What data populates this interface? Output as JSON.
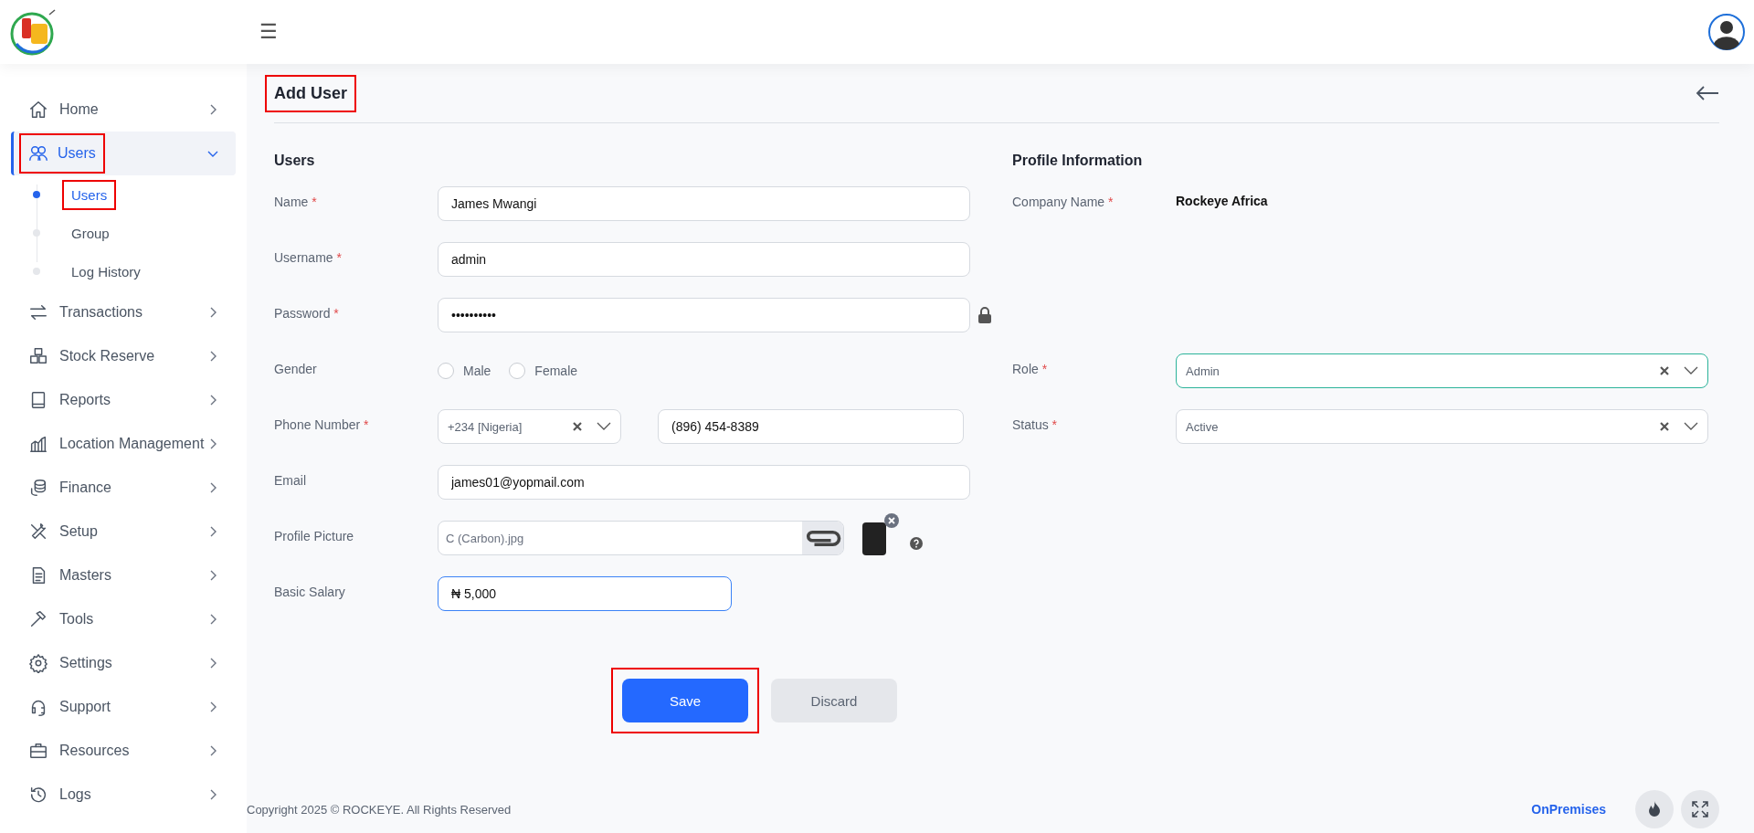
{
  "header": {
    "menu_label": "☰"
  },
  "sidebar": {
    "items": [
      {
        "label": "Home",
        "selected": false,
        "expanded": false,
        "highlighted": false
      },
      {
        "label": "Users",
        "selected": true,
        "expanded": true,
        "highlighted": true,
        "children": [
          {
            "label": "Users",
            "selected": true,
            "highlighted": true
          },
          {
            "label": "Group",
            "selected": false,
            "highlighted": false
          },
          {
            "label": "Log History",
            "selected": false,
            "highlighted": false
          }
        ]
      },
      {
        "label": "Transactions",
        "selected": false,
        "expanded": false,
        "highlighted": false
      },
      {
        "label": "Stock Reserve",
        "selected": false,
        "expanded": false,
        "highlighted": false
      },
      {
        "label": "Reports",
        "selected": false,
        "expanded": false,
        "highlighted": false
      },
      {
        "label": "Location Management",
        "selected": false,
        "expanded": false,
        "highlighted": false
      },
      {
        "label": "Finance",
        "selected": false,
        "expanded": false,
        "highlighted": false
      },
      {
        "label": "Setup",
        "selected": false,
        "expanded": false,
        "highlighted": false
      },
      {
        "label": "Masters",
        "selected": false,
        "expanded": false,
        "highlighted": false
      },
      {
        "label": "Tools",
        "selected": false,
        "expanded": false,
        "highlighted": false
      },
      {
        "label": "Settings",
        "selected": false,
        "expanded": false,
        "highlighted": false
      },
      {
        "label": "Support",
        "selected": false,
        "expanded": false,
        "highlighted": false
      },
      {
        "label": "Resources",
        "selected": false,
        "expanded": false,
        "highlighted": false
      },
      {
        "label": "Logs",
        "selected": false,
        "expanded": false,
        "highlighted": false
      }
    ]
  },
  "page": {
    "title": "Add User",
    "title_highlighted": true
  },
  "users_section": {
    "heading": "Users",
    "fields": [
      {
        "kind": "text",
        "label": "Name",
        "required_mark": "*",
        "value": "James Mwangi",
        "focused": false
      },
      {
        "kind": "text",
        "label": "Username",
        "required_mark": "*",
        "value": "admin",
        "focused": false
      },
      {
        "kind": "password",
        "label": "Password",
        "required_mark": "*",
        "value": "••••••••••",
        "focused": false
      },
      {
        "kind": "radio",
        "label": "Gender",
        "options": [
          {
            "label": "Male",
            "selected": false
          },
          {
            "label": "Female",
            "selected": false
          }
        ]
      },
      {
        "kind": "phone",
        "label": "Phone Number",
        "required_mark": "*",
        "country": "+234 [Nigeria]",
        "value": "(896) 454-8389"
      },
      {
        "kind": "text",
        "label": "Email",
        "value": "james01@yopmail.com",
        "focused": false
      },
      {
        "kind": "file",
        "label": "Profile Picture",
        "value": "C (Carbon).jpg"
      },
      {
        "kind": "currency",
        "label": "Basic Salary",
        "value": "₦ 5,000",
        "focused": true
      }
    ]
  },
  "profile_section": {
    "heading": "Profile Information",
    "fields": [
      {
        "kind": "static",
        "label": "Company Name",
        "required_mark": "*",
        "value": "Rockeye Africa"
      },
      {
        "kind": "blank"
      },
      {
        "kind": "blank"
      },
      {
        "kind": "select",
        "label": "Role",
        "required_mark": "*",
        "value": "Admin",
        "focused": true
      },
      {
        "kind": "select",
        "label": "Status",
        "required_mark": "*",
        "value": "Active",
        "focused": false
      }
    ]
  },
  "buttons": [
    {
      "kind": "primary",
      "label": "Save",
      "highlighted": true
    },
    {
      "kind": "secondary",
      "label": "Discard",
      "highlighted": false
    }
  ],
  "footer": {
    "copyright": "Copyright 2025 © ROCKEYE. All Rights Reserved",
    "mode": "OnPremises"
  }
}
